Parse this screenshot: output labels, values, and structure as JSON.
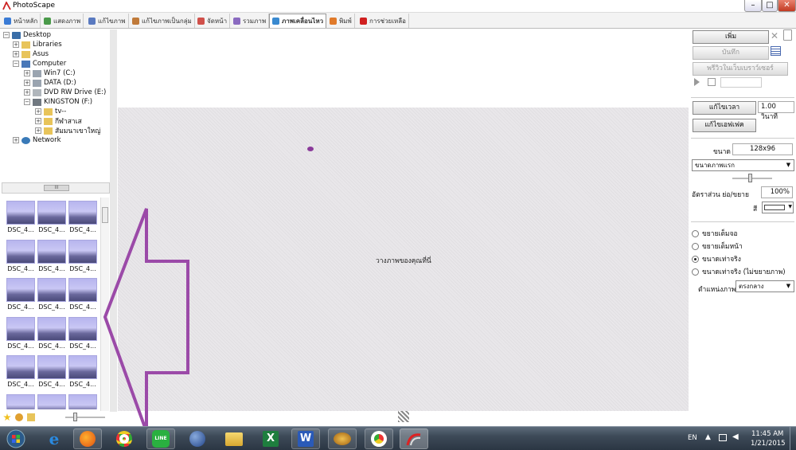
{
  "window": {
    "title": "PhotoScape"
  },
  "tabs": [
    {
      "label": "หน้าหลัก",
      "color": "#3a7bd5",
      "active": false
    },
    {
      "label": "แสดงภาพ",
      "color": "#4a9a4a",
      "active": false
    },
    {
      "label": "แก้ไขภาพ",
      "color": "#5a7ac0",
      "active": false
    },
    {
      "label": "แก้ไขภาพเป็นกลุ่ม",
      "color": "#c07a3a",
      "active": false
    },
    {
      "label": "จัดหน้า",
      "color": "#d0504a",
      "active": false
    },
    {
      "label": "รวมภาพ",
      "color": "#8a6ac0",
      "active": false
    },
    {
      "label": "ภาพเคลื่อนไหว",
      "color": "#3a8ad0",
      "active": true
    },
    {
      "label": "พิมพ์",
      "color": "#e07a2a",
      "active": false
    },
    {
      "label": "การช่วยเหลือ",
      "color": "#d02020",
      "active": false
    }
  ],
  "tree": {
    "items": [
      {
        "label": "Desktop",
        "expander": "⊟"
      },
      {
        "label": "Libraries",
        "expander": "⊞"
      },
      {
        "label": "Asus",
        "expander": "⊞"
      },
      {
        "label": "Computer",
        "expander": "⊟"
      },
      {
        "label": "Win7 (C:)",
        "expander": "⊞"
      },
      {
        "label": "DATA (D:)",
        "expander": "⊞"
      },
      {
        "label": "DVD RW Drive (E:)",
        "expander": "⊞"
      },
      {
        "label": "KINGSTON (F:)",
        "expander": "⊟"
      },
      {
        "label": "tv--",
        "expander": "⊞"
      },
      {
        "label": "กีฬาสาเส",
        "expander": "⊞"
      },
      {
        "label": "สัมมนาเขาใหญ่",
        "expander": "⊞"
      },
      {
        "label": "Network",
        "expander": "⊞"
      }
    ],
    "hscroll_grip": "III"
  },
  "thumbnails": {
    "label": "DSC_4...",
    "count": 18
  },
  "canvas": {
    "drop_text": "วางภาพของคุณที่นี่"
  },
  "right_panel": {
    "add_button": "เพิ่ม",
    "save_button": "บันทึก",
    "preview_browser_button": "พรีวิวในเว็บเบราว์เซอร์",
    "edit_time_button": "แก้ไขเวลา",
    "time_value": "1.00 วินาที",
    "edit_effect_button": "แก้ไขเอฟเฟค",
    "size_label": "ขนาด",
    "size_value": "128x96",
    "size_mode": "ขนาดภาพแรก",
    "ratio_label": "อัตราส่วน ย่อ/ขยาย",
    "ratio_value": "100%",
    "color_label": "สี",
    "radio_options": [
      {
        "label": "ขยายเต็มจอ",
        "checked": false
      },
      {
        "label": "ขยายเต็มหน้า",
        "checked": false
      },
      {
        "label": "ขนาดเท่าจริง",
        "checked": true
      },
      {
        "label": "ขนาดเท่าจริง (ไม่ขยายภาพ)",
        "checked": false
      }
    ],
    "position_label": "ตำแหน่งภาพ",
    "position_value": "ตรงกลาง"
  },
  "taskbar": {
    "language": "EN",
    "time": "11:45 AM",
    "date": "1/21/2015",
    "apps": [
      "start-orb",
      "internet-explorer",
      "firefox",
      "chrome",
      "line",
      "google-earth",
      "file-explorer",
      "excel",
      "word",
      "media-app",
      "chrome-2",
      "photoscape"
    ]
  },
  "colors": {
    "arrow": "#9b4aa8",
    "canvas_bg": "#e9e7ea",
    "thumb_accent": "#b7b5ee",
    "taskbar": "#3d4a58"
  }
}
